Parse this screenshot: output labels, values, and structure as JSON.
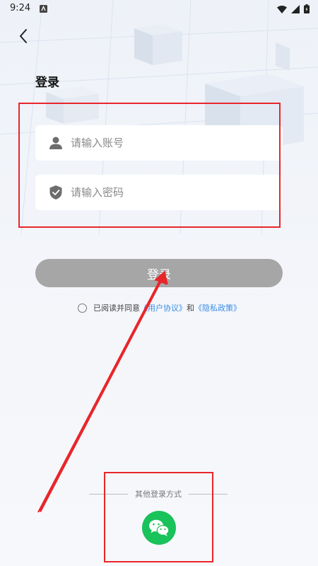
{
  "status_bar": {
    "time": "9:24"
  },
  "header": {
    "title": "登录"
  },
  "form": {
    "account_placeholder": "请输入账号",
    "password_placeholder": "请输入密码"
  },
  "login_button_label": "登录",
  "agreement": {
    "prefix": "已阅读并同意",
    "user_agreement": "《用户协议》",
    "and": "和",
    "privacy_policy": "《隐私政策》"
  },
  "other_login": {
    "label": "其他登录方式"
  },
  "colors": {
    "accent_link": "#3a8ee6",
    "login_button_disabled": "#a6a6a6",
    "wechat_green": "#19c25a",
    "annotation_red": "#e8262a"
  },
  "icons": {
    "back": "back-arrow-icon",
    "account": "user-icon",
    "password": "shield-check-icon",
    "wechat": "wechat-icon"
  }
}
